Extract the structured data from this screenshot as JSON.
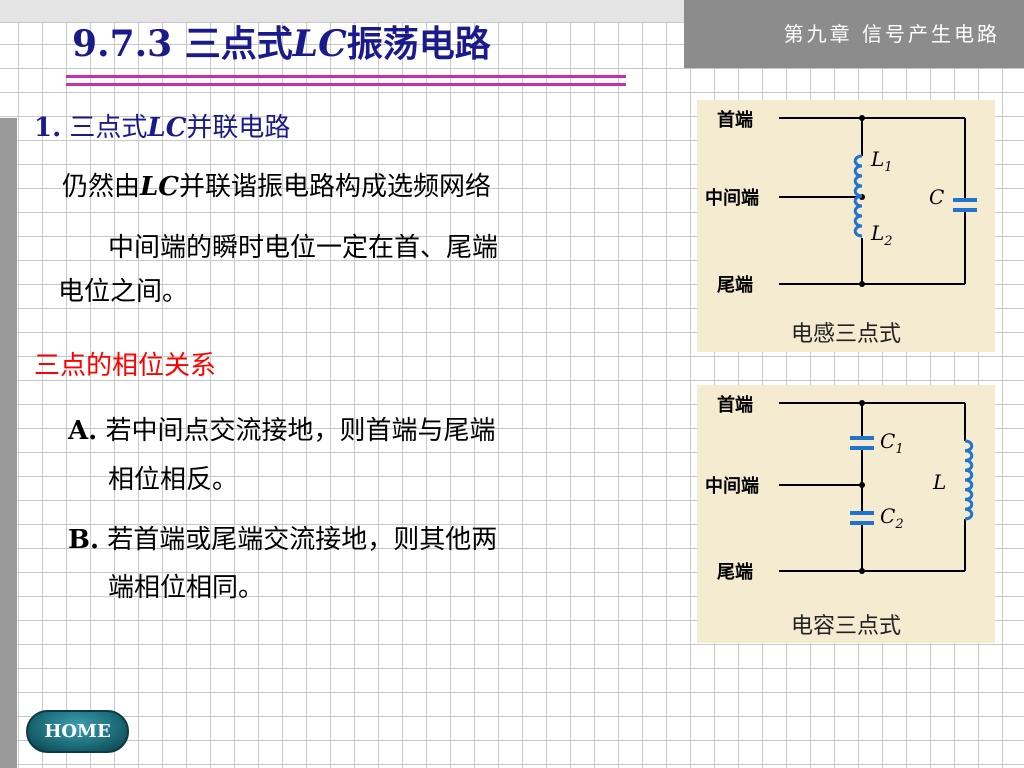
{
  "header": {
    "chapter": "第九章  信号产生电路",
    "title_prefix": "9.7.3  三点式",
    "title_italic": "LC",
    "title_suffix": "振荡电路"
  },
  "section1": {
    "number": "1.",
    "heading_prefix": " 三点式",
    "heading_italic": "LC",
    "heading_suffix": "并联电路"
  },
  "para1": {
    "prefix": "仍然由",
    "italic": "LC",
    "suffix": "并联谐振电路构成选频网络"
  },
  "para2": {
    "line1": "中间端的瞬时电位一定在首、尾端",
    "line2": "电位之间。"
  },
  "phase": {
    "heading": "三点的相位关系",
    "a_marker": "A.",
    "a_line1": " 若中间点交流接地，则首端与尾端",
    "a_line2": "相位相反。",
    "b_marker": "B.",
    "b_line1": " 若首端或尾端交流接地，则其他两",
    "b_line2": "端相位相同。"
  },
  "figure_inductive": {
    "term_top": "首端",
    "term_mid": "中间端",
    "term_bot": "尾端",
    "l1": "L",
    "l1_sub": "1",
    "l2": "L",
    "l2_sub": "2",
    "c": "C",
    "caption": "电感三点式"
  },
  "figure_capacitive": {
    "term_top": "首端",
    "term_mid": "中间端",
    "term_bot": "尾端",
    "c1": "C",
    "c1_sub": "1",
    "c2": "C",
    "c2_sub": "2",
    "l": "L",
    "caption": "电容三点式"
  },
  "nav": {
    "home": "HOME"
  }
}
